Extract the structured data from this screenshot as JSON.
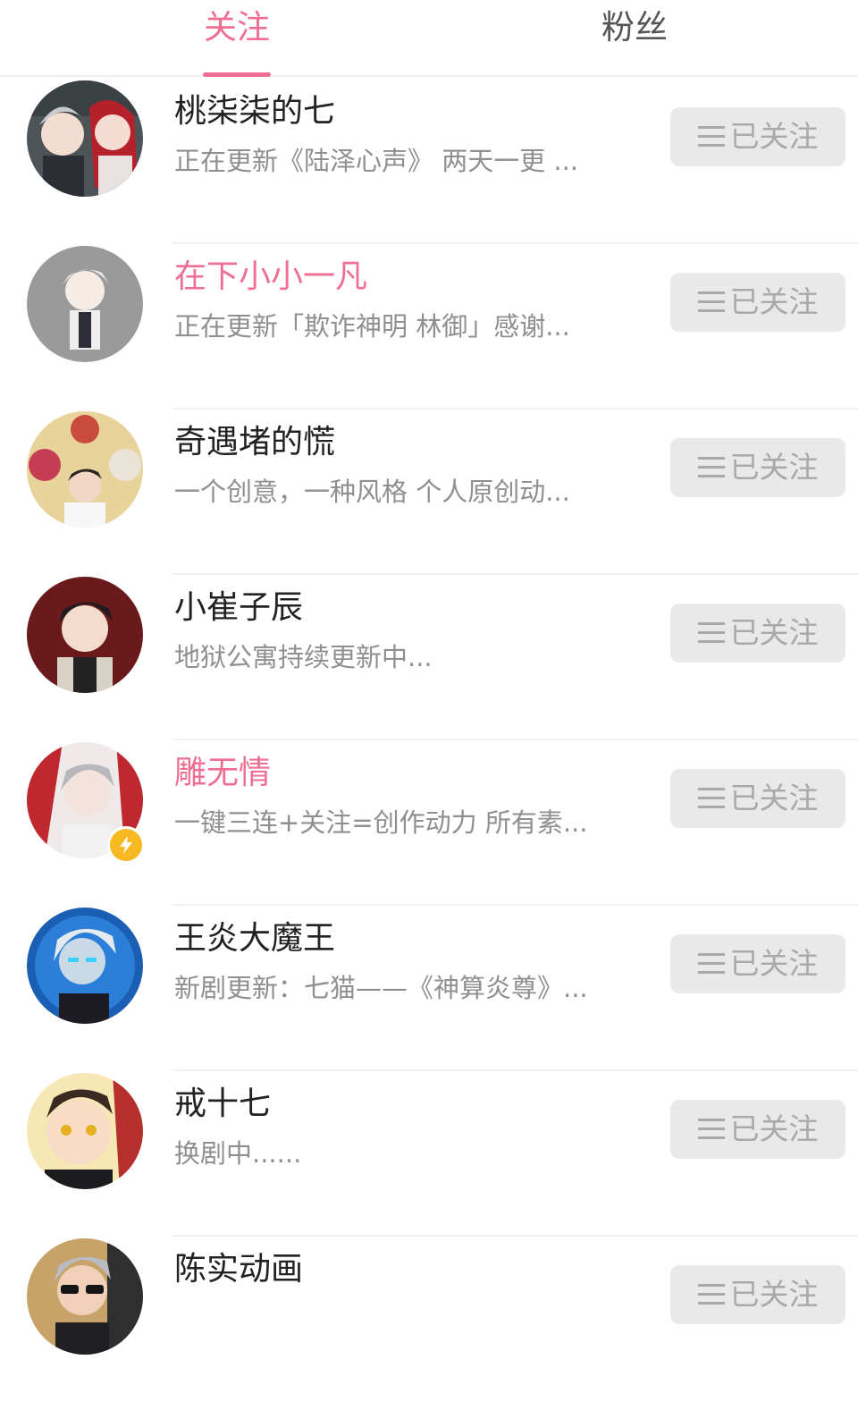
{
  "tabs": [
    {
      "label": "关注",
      "active": true
    },
    {
      "label": "粉丝",
      "active": false
    }
  ],
  "colors": {
    "accent": "#f06e94",
    "button_bg": "#e9e9e9",
    "button_text": "#a9a9a9",
    "desc_text": "#8f8f8f"
  },
  "follow_label": "已关注",
  "users": [
    {
      "name": "桃柒柒的七",
      "desc": "正在更新《陆泽心声》 两天一更 ...",
      "highlight": false,
      "badge": false
    },
    {
      "name": "在下小小一凡",
      "desc": "正在更新「欺诈神明 林御」感谢...",
      "highlight": true,
      "badge": false
    },
    {
      "name": "奇遇堵的慌",
      "desc": "一个创意，一种风格 个人原创动...",
      "highlight": false,
      "badge": false
    },
    {
      "name": "小崔子辰",
      "desc": "地狱公寓持续更新中...",
      "highlight": false,
      "badge": false
    },
    {
      "name": "雕无情",
      "desc": "一键三连+关注=创作动力 所有素...",
      "highlight": true,
      "badge": true
    },
    {
      "name": "王炎大魔王",
      "desc": "新剧更新：七猫——《神算炎尊》...",
      "highlight": false,
      "badge": false
    },
    {
      "name": "戒十七",
      "desc": "换剧中......",
      "highlight": false,
      "badge": false
    },
    {
      "name": "陈实动画",
      "desc": "",
      "highlight": false,
      "badge": false
    }
  ]
}
